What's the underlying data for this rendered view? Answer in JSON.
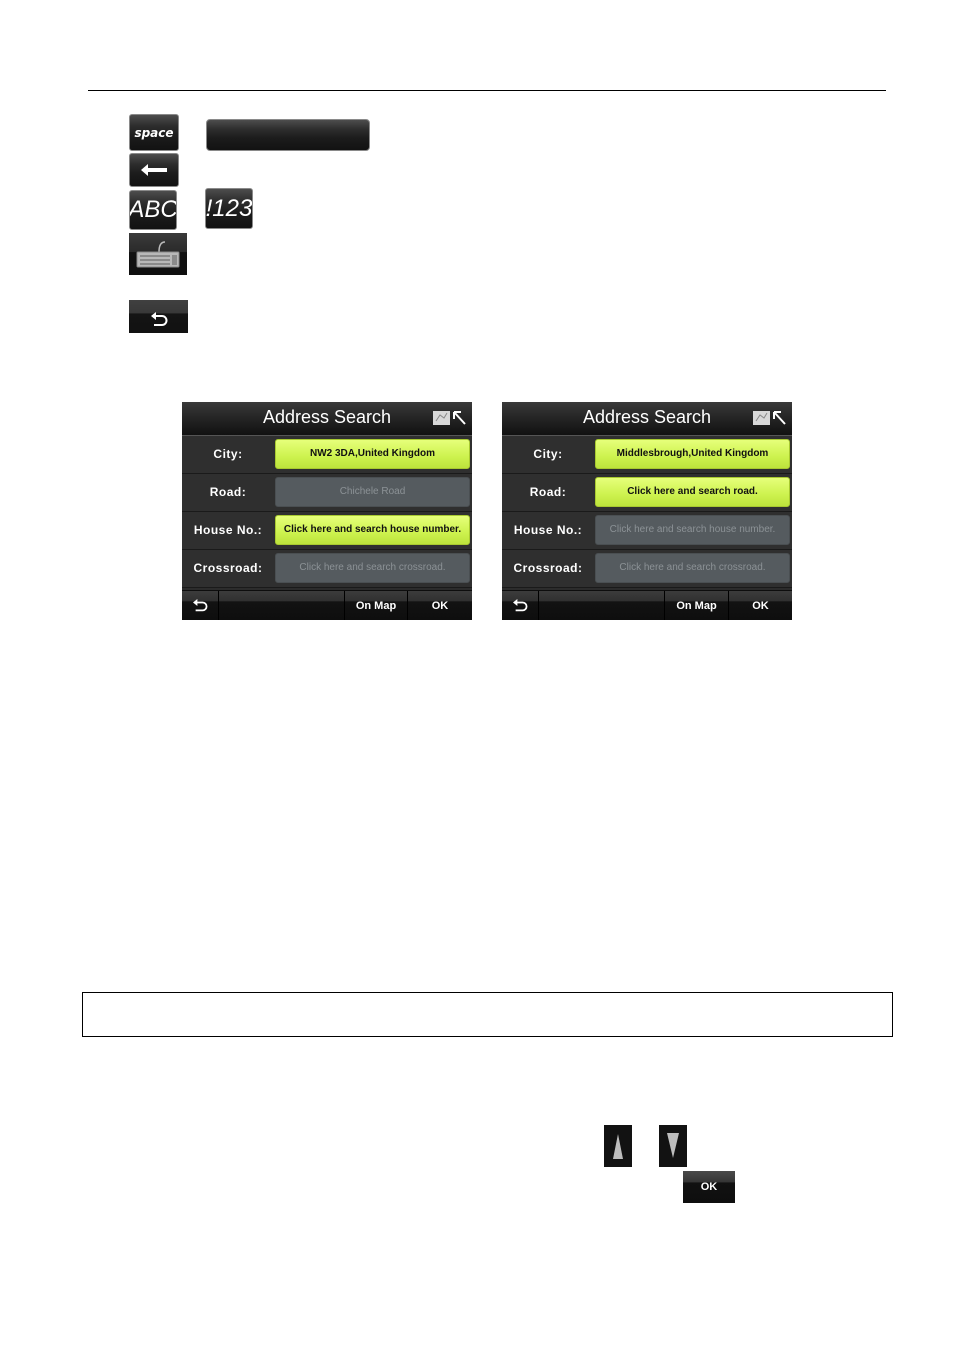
{
  "page": {
    "header_rule": true
  },
  "legend_keys": {
    "space_label": "space",
    "backspace_icon": "arrow-left-icon",
    "abc_label": "ABC",
    "num_label": "!123",
    "keyboard_icon": "keyboard-icon",
    "undo_icon": "undo-icon"
  },
  "screens": [
    {
      "title": "Address Search",
      "title_icon": "map-cursor-icon",
      "rows": [
        {
          "label": "City:",
          "value": "NW2 3DA,United Kingdom",
          "state": "active"
        },
        {
          "label": "Road:",
          "value": "Chichele Road",
          "state": "inactive"
        },
        {
          "label": "House No.:",
          "value": "Click here and search house number.",
          "state": "active"
        },
        {
          "label": "Crossroad:",
          "value": "Click here and search crossroad.",
          "state": "inactive"
        }
      ],
      "buttons": {
        "back_icon": "undo-icon",
        "blank": "",
        "on_map": "On Map",
        "ok": "OK"
      }
    },
    {
      "title": "Address Search",
      "title_icon": "map-cursor-icon",
      "rows": [
        {
          "label": "City:",
          "value": "Middlesbrough,United Kingdom",
          "state": "active"
        },
        {
          "label": "Road:",
          "value": "Click here and search road.",
          "state": "active"
        },
        {
          "label": "House No.:",
          "value": "Click here and search house number.",
          "state": "inactive"
        },
        {
          "label": "Crossroad:",
          "value": "Click here and search crossroad.",
          "state": "inactive"
        }
      ],
      "buttons": {
        "back_icon": "undo-icon",
        "blank": "",
        "on_map": "On Map",
        "ok": "OK"
      }
    }
  ],
  "note_box": {
    "text": ""
  },
  "nav_keys": {
    "up_icon": "triangle-up-icon",
    "down_icon": "triangle-down-icon",
    "ok_label": "OK"
  },
  "colors": {
    "active_field": "#cdf24e",
    "inactive_field": "#555b5f",
    "screen_bg": "#2c2c2c"
  }
}
